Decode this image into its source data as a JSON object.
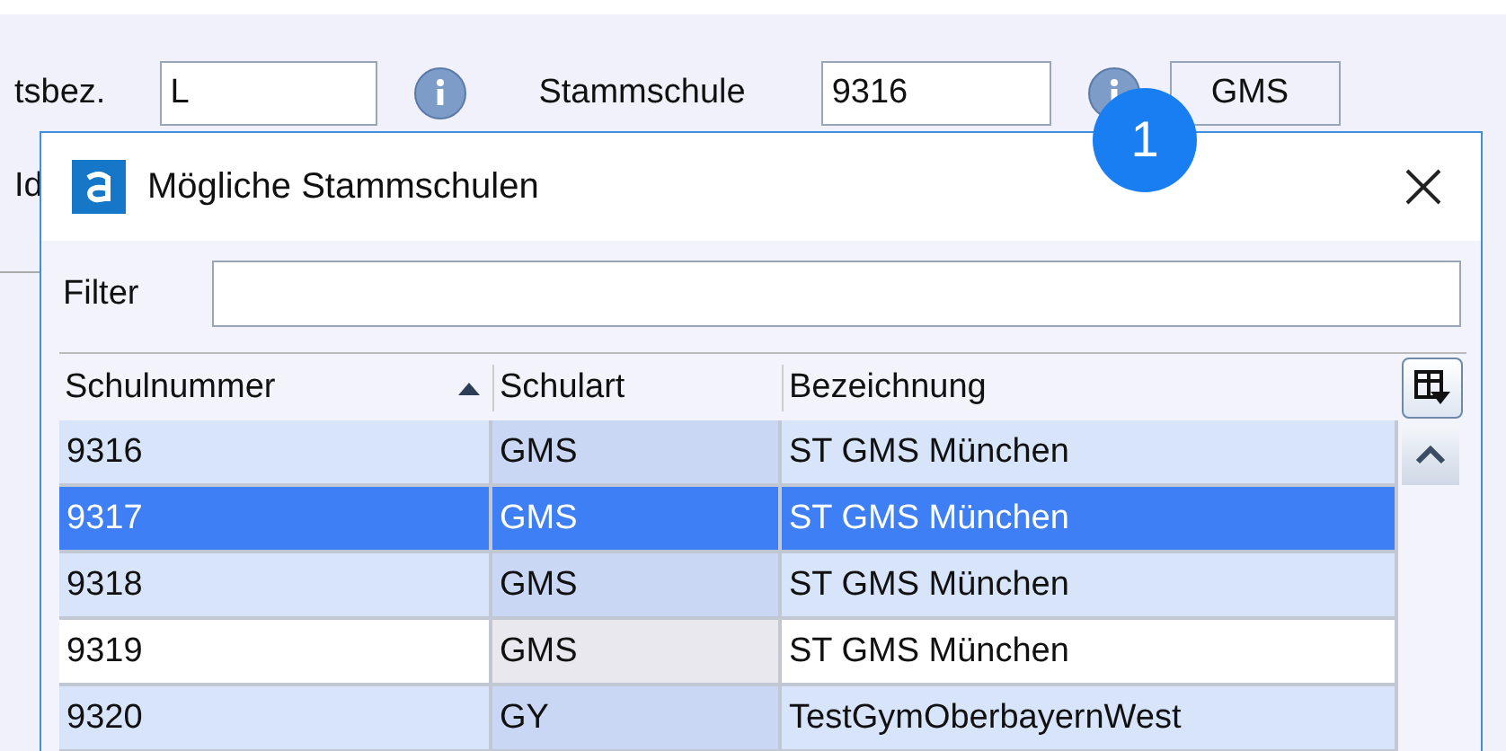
{
  "form": {
    "items": [
      {
        "kind": "label",
        "text": "tsbez."
      },
      {
        "kind": "field",
        "text": "L"
      },
      {
        "kind": "info"
      },
      {
        "kind": "label",
        "text": "Stammschule"
      },
      {
        "kind": "field",
        "text": "9316"
      },
      {
        "kind": "info"
      },
      {
        "kind": "field",
        "text": "GMS"
      }
    ],
    "second_label": "Id"
  },
  "badge": "1",
  "dialog": {
    "title": "Mögliche Stammschulen",
    "filter_label": "Filter",
    "table": {
      "columns": [
        {
          "label": "Schulnummer",
          "sorted": true
        },
        {
          "label": "Schulart",
          "sorted": false
        },
        {
          "label": "Bezeichnung",
          "sorted": false
        }
      ],
      "rows": [
        {
          "cells": [
            "9316",
            "GMS",
            "ST GMS München"
          ],
          "selected": false,
          "highlighted": true
        },
        {
          "cells": [
            "9317",
            "GMS",
            "ST GMS München"
          ],
          "selected": true,
          "highlighted": true
        },
        {
          "cells": [
            "9318",
            "GMS",
            "ST GMS München"
          ],
          "selected": false,
          "highlighted": true
        },
        {
          "cells": [
            "9319",
            "GMS",
            "ST GMS München"
          ],
          "selected": false,
          "highlighted": false
        },
        {
          "cells": [
            "9320",
            "GY",
            "TestGymOberbayernWest"
          ],
          "selected": false,
          "highlighted": true
        }
      ]
    }
  }
}
